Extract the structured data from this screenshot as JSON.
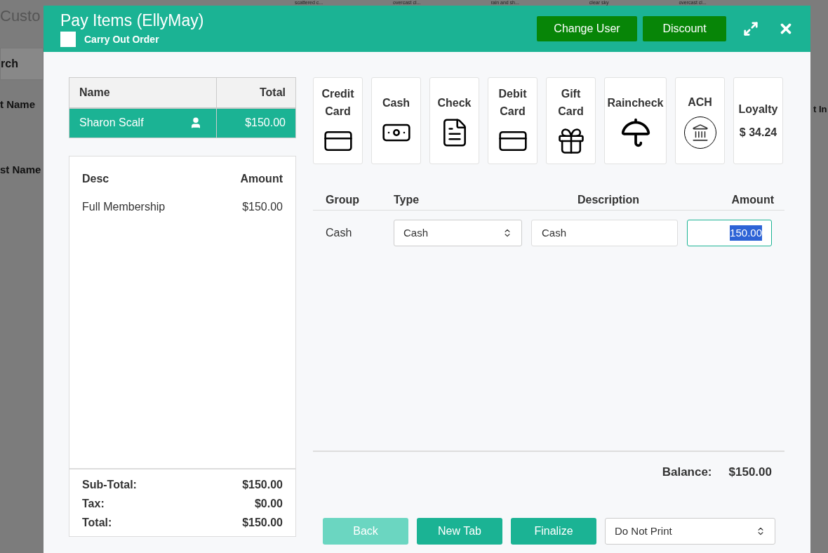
{
  "background": {
    "title": "Custo",
    "weather": [
      "scattered c...",
      "overcast cl...",
      "rain and sh...",
      "clear sky",
      "overcast cl..."
    ],
    "tab": "rch",
    "left_headers": [
      "t Name",
      "st Name"
    ],
    "right_header": "t In"
  },
  "modal": {
    "title": "Pay Items (EllyMay)",
    "carry_out": {
      "label": "Carry Out Order",
      "checked": false
    },
    "header_buttons": [
      "Change User",
      "Discount"
    ]
  },
  "customers": {
    "columns": [
      "Name",
      "Total"
    ],
    "rows": [
      {
        "name": "Sharon Scalf",
        "total": "$150.00",
        "selected": true
      }
    ]
  },
  "items": {
    "columns": [
      "Desc",
      "Amount"
    ],
    "rows": [
      {
        "desc": "Full Membership",
        "amount": "$150.00"
      }
    ]
  },
  "totals": [
    {
      "label": "Sub-Total:",
      "value": "$150.00"
    },
    {
      "label": "Tax:",
      "value": "$0.00"
    },
    {
      "label": "Total:",
      "value": "$150.00"
    }
  ],
  "payment_methods": [
    {
      "label": "Credit Card",
      "kind": "card"
    },
    {
      "label": "Cash",
      "kind": "cash"
    },
    {
      "label": "Check",
      "kind": "check"
    },
    {
      "label": "Debit Card",
      "kind": "card"
    },
    {
      "label": "Gift Card",
      "kind": "gift"
    },
    {
      "label": "Raincheck",
      "kind": "umbrella"
    },
    {
      "label": "ACH",
      "kind": "bank"
    },
    {
      "label": "Loyalty",
      "kind": "amount",
      "amount": "$ 34.24"
    }
  ],
  "payments": {
    "columns": [
      "Group",
      "Type",
      "Description",
      "Amount"
    ],
    "rows": [
      {
        "group": "Cash",
        "type": "Cash",
        "description": "Cash",
        "amount": "150.00"
      }
    ]
  },
  "balance": {
    "label": "Balance:",
    "value": "$150.00"
  },
  "footer_buttons": [
    {
      "label": "Back",
      "disabled": true
    },
    {
      "label": "New Tab",
      "disabled": false
    },
    {
      "label": "Finalize",
      "disabled": false
    }
  ],
  "print_option": "Do Not Print"
}
